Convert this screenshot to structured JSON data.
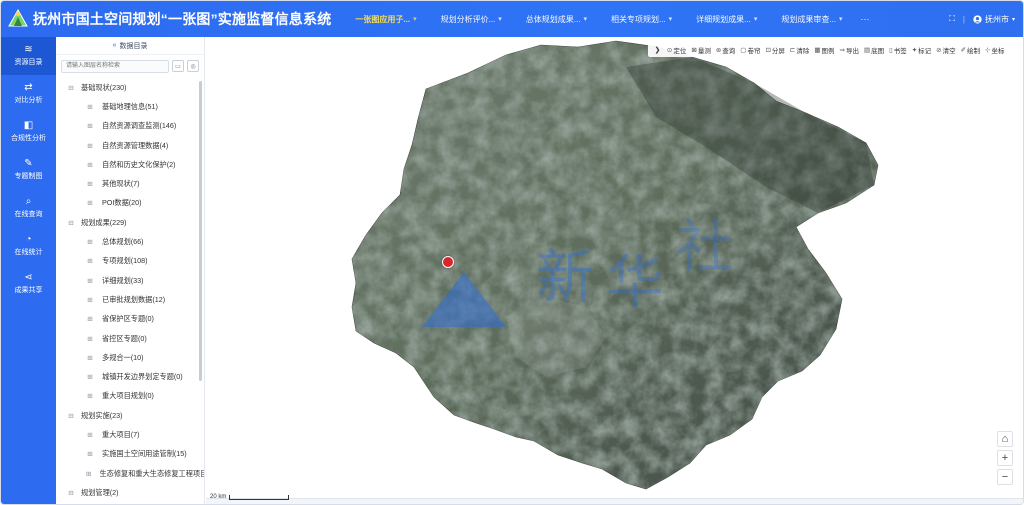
{
  "app": {
    "title": "抚州市国土空间规划“一张图”实施监督信息系统"
  },
  "nav": {
    "items": [
      {
        "label": "一张图应用子...",
        "active": true
      },
      {
        "label": "规划分析评价...",
        "active": false
      },
      {
        "label": "总体规划成果...",
        "active": false
      },
      {
        "label": "相关专项规划...",
        "active": false
      },
      {
        "label": "详细规划成果...",
        "active": false
      },
      {
        "label": "规划成果审查...",
        "active": false
      }
    ],
    "more": "···"
  },
  "top_right": {
    "fullscreen_icon": "⛶",
    "region_label": "抚州市"
  },
  "sidebar": {
    "items": [
      {
        "label": "资源目录",
        "icon": "≋",
        "active": true
      },
      {
        "label": "对比分析",
        "icon": "⇄",
        "active": false
      },
      {
        "label": "合规性分析",
        "icon": "◧",
        "active": false
      },
      {
        "label": "专题制图",
        "icon": "✎",
        "active": false
      },
      {
        "label": "在线查询",
        "icon": "⌕",
        "active": false
      },
      {
        "label": "在线统计",
        "icon": "◔",
        "active": false
      },
      {
        "label": "成果共享",
        "icon": "⋖",
        "active": false
      }
    ]
  },
  "panel": {
    "title": "数据目录",
    "search_placeholder": "请输入图层名称检索"
  },
  "tree": [
    {
      "label": "基础现状(230)",
      "level": 0
    },
    {
      "label": "基础地理信息(51)",
      "level": 1
    },
    {
      "label": "自然资源调查监测(146)",
      "level": 1
    },
    {
      "label": "自然资源管理数据(4)",
      "level": 1
    },
    {
      "label": "自然和历史文化保护(2)",
      "level": 1
    },
    {
      "label": "其他现状(7)",
      "level": 1
    },
    {
      "label": "POI数据(20)",
      "level": 1
    },
    {
      "label": "规划成果(229)",
      "level": 0
    },
    {
      "label": "总体规划(66)",
      "level": 1
    },
    {
      "label": "专项规划(108)",
      "level": 1
    },
    {
      "label": "详细规划(33)",
      "level": 1
    },
    {
      "label": "已审批规划数据(12)",
      "level": 1
    },
    {
      "label": "省保护区专题(0)",
      "level": 1
    },
    {
      "label": "省控区专题(0)",
      "level": 1
    },
    {
      "label": "多规合一(10)",
      "level": 1
    },
    {
      "label": "城镇开发边界划定专题(0)",
      "level": 1
    },
    {
      "label": "重大项目规划(0)",
      "level": 1
    },
    {
      "label": "规划实施(23)",
      "level": 0
    },
    {
      "label": "重大项目(7)",
      "level": 1
    },
    {
      "label": "实施国土空间用途管制(15)",
      "level": 1
    },
    {
      "label": "生态修复和重大生态修复工程项目",
      "level": 1
    },
    {
      "label": "规划管理(2)",
      "level": 0
    }
  ],
  "toolbar": [
    {
      "icon": "⊙",
      "label": "定位"
    },
    {
      "icon": "⊠",
      "label": "量测"
    },
    {
      "icon": "⊛",
      "label": "查询"
    },
    {
      "icon": "▢",
      "label": "卷帘"
    },
    {
      "icon": "⊡",
      "label": "分屏"
    },
    {
      "icon": "⊏",
      "label": "清除"
    },
    {
      "icon": "▦",
      "label": "图例"
    },
    {
      "icon": "⇒",
      "label": "导出"
    },
    {
      "icon": "▤",
      "label": "底图"
    },
    {
      "icon": "▯",
      "label": "书签"
    },
    {
      "icon": "✦",
      "label": "标记"
    },
    {
      "icon": "⊘",
      "label": "清空"
    },
    {
      "icon": "✐",
      "label": "绘制"
    },
    {
      "icon": "⊹",
      "label": "坐标"
    }
  ],
  "map": {
    "scale_label": "20 km",
    "home_icon": "⌂",
    "zoom_in": "+",
    "zoom_out": "−",
    "marker_color": "#d8262c"
  },
  "colors": {
    "brand": "#2d6bf0",
    "nav_active": "#ffe14a"
  }
}
